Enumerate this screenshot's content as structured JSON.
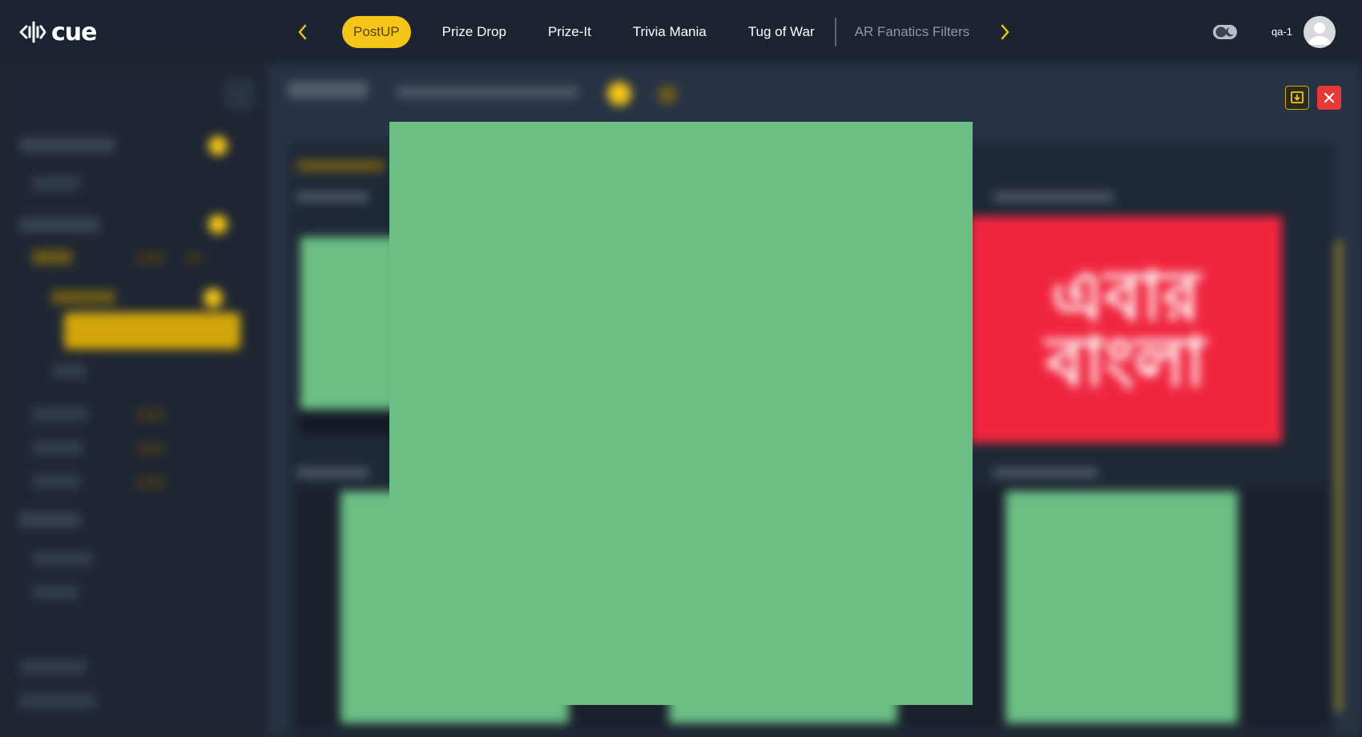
{
  "app": {
    "logo_text": "cue"
  },
  "nav": {
    "tabs": [
      {
        "label": "PostUP",
        "state": "active"
      },
      {
        "label": "Prize Drop",
        "state": "normal"
      },
      {
        "label": "Prize-It",
        "state": "normal"
      },
      {
        "label": "Trivia Mania",
        "state": "normal"
      },
      {
        "label": "Tug of War",
        "state": "normal"
      },
      {
        "label": "AR Fanatics Filters",
        "state": "dim"
      }
    ],
    "prev_icon": "chevron-left-icon",
    "next_icon": "chevron-right-icon"
  },
  "user": {
    "name": "qa-1",
    "theme_toggle_icon": "theme-toggle-icon",
    "avatar_icon": "user-avatar-icon"
  },
  "red_card": {
    "line1": "এবার",
    "line2": "বাংলা"
  },
  "actions": {
    "download_icon": "download-icon",
    "close_icon": "close-icon"
  },
  "colors": {
    "accent": "#f5c518",
    "topbar_bg": "#1c2431",
    "sidebar_bg": "#1e2633",
    "main_bg": "#273244",
    "placeholder_green": "#6bbf85",
    "card_red": "#f0263f",
    "close_red": "#e53935"
  }
}
